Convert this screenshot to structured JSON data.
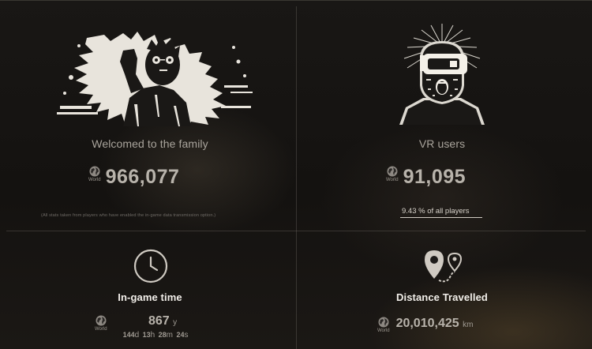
{
  "panels": {
    "family": {
      "title": "Welcomed to the family",
      "scope": "World",
      "value": "966,077",
      "note": "(All stats taken from players who have enabled the in-game data transmission option.)",
      "illustration": "screaming-man-illustration"
    },
    "vr": {
      "title": "VR users",
      "scope": "World",
      "value": "91,095",
      "percent": "9.43",
      "percent_suffix": "% of all players",
      "illustration": "vr-headset-man-illustration"
    },
    "time": {
      "title": "In-game time",
      "scope": "World",
      "years": "867",
      "years_unit": "y",
      "days": "144",
      "days_unit": "d",
      "hours": "13",
      "hours_unit": "h",
      "minutes": "28",
      "minutes_unit": "m",
      "seconds": "24",
      "seconds_unit": "s",
      "icon": "clock-icon"
    },
    "distance": {
      "title": "Distance Travelled",
      "scope": "World",
      "value": "20,010,425",
      "unit": "km",
      "icon": "map-route-icon"
    }
  },
  "colors": {
    "accent_text": "#f2efea",
    "muted_text": "#a9a49c",
    "background": "#161412"
  }
}
